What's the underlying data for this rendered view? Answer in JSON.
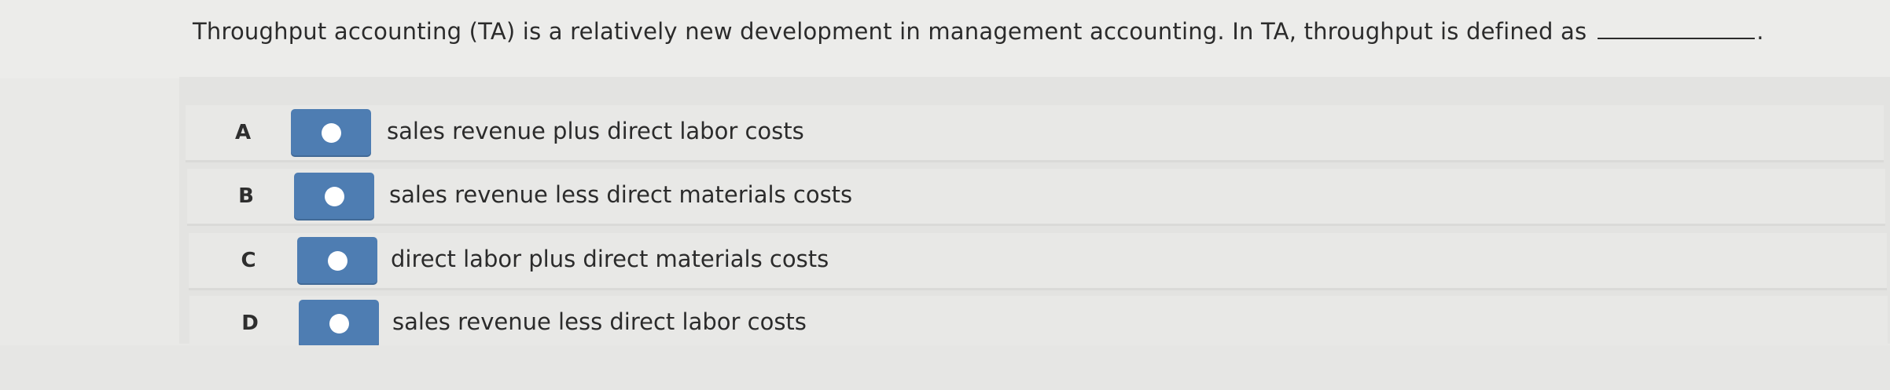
{
  "question": {
    "text": "Throughput accounting (TA) is a relatively new development in management accounting. In TA, throughput is defined as",
    "period": "."
  },
  "options": [
    {
      "letter": "A",
      "text": "sales revenue plus direct labor costs"
    },
    {
      "letter": "B",
      "text": "sales revenue less direct materials costs"
    },
    {
      "letter": "C",
      "text": "direct labor plus direct materials costs"
    },
    {
      "letter": "D",
      "text": "sales revenue less direct labor costs"
    }
  ],
  "colors": {
    "radio_button": "#4e7db2",
    "background": "#e9e9e7"
  }
}
